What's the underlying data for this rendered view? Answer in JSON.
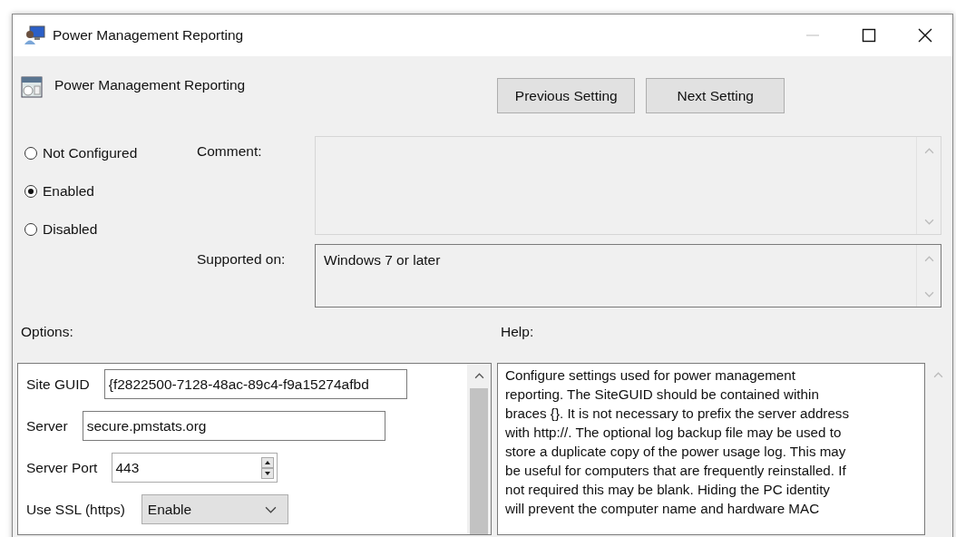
{
  "window": {
    "title": "Power Management Reporting"
  },
  "setting": {
    "title": "Power Management Reporting"
  },
  "nav_buttons": [
    "Previous Setting",
    "Next Setting"
  ],
  "state_options": [
    {
      "label": "Not Configured",
      "selected": false
    },
    {
      "label": "Enabled",
      "selected": true
    },
    {
      "label": "Disabled",
      "selected": false
    }
  ],
  "comment": {
    "label": "Comment:"
  },
  "supported_on": {
    "label": "Supported on:",
    "value": "Windows 7 or later"
  },
  "options": {
    "label": "Options:",
    "fields": [
      {
        "kind": "text",
        "label": "Site GUID",
        "value": "{f2822500-7128-48ac-89c4-f9a15274afbd"
      },
      {
        "kind": "text",
        "label": "Server",
        "value": "secure.pmstats.org"
      },
      {
        "kind": "spin",
        "label": "Server Port",
        "value": "443"
      },
      {
        "kind": "select",
        "label": "Use SSL (https)",
        "value": "Enable"
      }
    ]
  },
  "help": {
    "label": "Help:",
    "lines": [
      "Configure settings used for power management",
      "reporting. The SiteGUID should be contained within",
      "braces {}. It is not necessary to prefix the server address",
      "with http://. The optional log backup file may be used to",
      "store a duplicate copy of the power usage log. This may",
      "be useful for computers that are frequently reinstalled. If",
      "not required this may be blank. Hiding the PC identity",
      "will prevent the computer name and hardware MAC"
    ]
  }
}
